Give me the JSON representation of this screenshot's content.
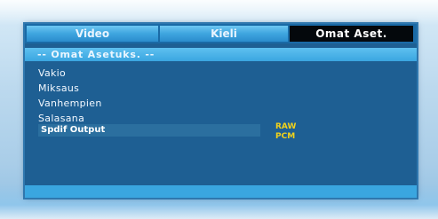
{
  "tabs": [
    {
      "label": "Video"
    },
    {
      "label": "Kieli"
    },
    {
      "label": "Omat Aset."
    }
  ],
  "section_header": "-- Omat Asetuks. --",
  "menu": [
    {
      "label": "Vakio"
    },
    {
      "label": "Miksaus"
    },
    {
      "label": "Vanhempien"
    },
    {
      "label": "Salasana"
    }
  ],
  "spdif": {
    "label": "Spdif Output",
    "options": [
      "RAW",
      "PCM"
    ]
  },
  "colors": {
    "panel": "#1e5f93",
    "tab_active": "#04080c",
    "option_text": "#f2d21a"
  }
}
